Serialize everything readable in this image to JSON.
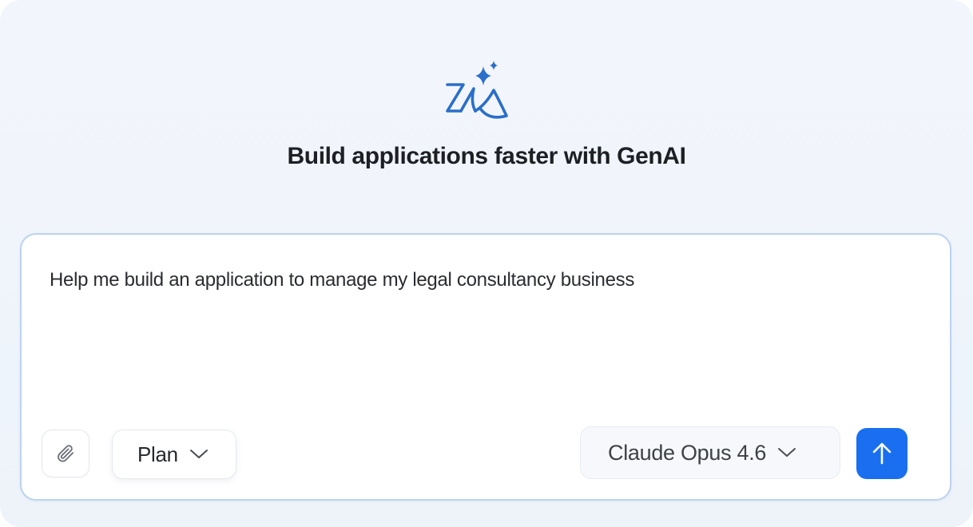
{
  "header": {
    "logo_icon": "zia-ai-sparkle-icon",
    "title": "Build applications faster with GenAI"
  },
  "composer": {
    "prompt_value": "Help me build an application to manage my legal consultancy business",
    "attach_icon": "paperclip-icon",
    "plan_mode": {
      "label": "Plan",
      "icon": "chevron-down-icon"
    },
    "model_select": {
      "label": "Claude Opus 4.6",
      "icon": "chevron-down-icon"
    },
    "send_icon": "arrow-up-icon"
  },
  "colors": {
    "accent": "#1a6ff0",
    "logo_blue": "#2a6fc9",
    "composer_border": "#bcd3ef",
    "background": "#f1f5fb"
  }
}
